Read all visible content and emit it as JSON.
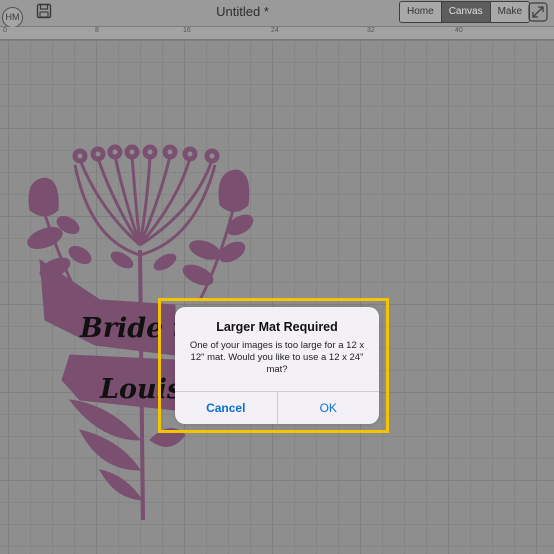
{
  "topbar": {
    "avatar_initials": "HM",
    "title": "Untitled *",
    "tabs": [
      {
        "label": "Home"
      },
      {
        "label": "Canvas"
      },
      {
        "label": "Make"
      }
    ]
  },
  "ruler": {
    "ticks": [
      "0",
      "8",
      "16",
      "24",
      "32",
      "40"
    ]
  },
  "artwork": {
    "line1": "Bride to",
    "line2": "Louisa",
    "color": "#7a4f70"
  },
  "dialog": {
    "title": "Larger Mat Required",
    "message": "One of your images is too large for a 12 x 12\" mat. Would you like to use a 12 x 24\" mat?",
    "cancel_label": "Cancel",
    "ok_label": "OK"
  },
  "colors": {
    "highlight": "#f5c400",
    "link": "#0a6fd8"
  }
}
